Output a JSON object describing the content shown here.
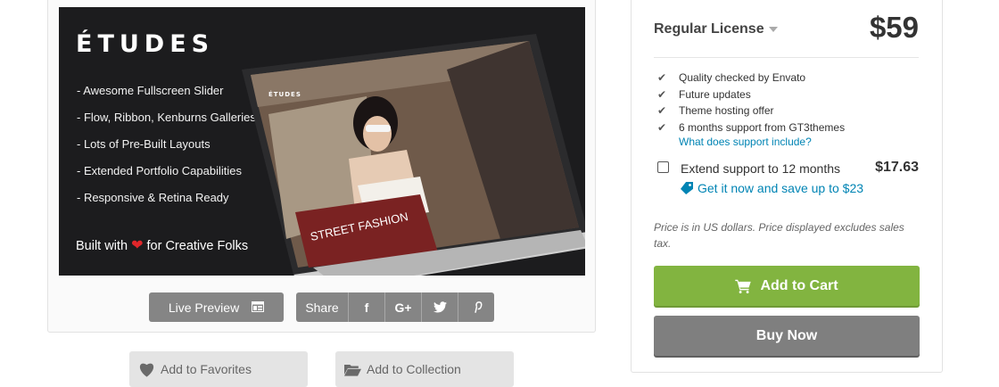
{
  "preview": {
    "banner": {
      "title": "ÉTUDES",
      "features": [
        "- Awesome Fullscreen Slider",
        "- Flow, Ribbon, Kenburns Galleries",
        "- Lots of Pre-Built Layouts",
        "- Extended Portfolio Capabilities",
        "- Responsive & Retina Ready"
      ],
      "built_with_prefix": "Built with",
      "built_with_suffix": "for Creative Folks",
      "screen_caption": "STREET FASHION",
      "screen_logo": "ÉTUDES"
    },
    "live_preview_label": "Live Preview",
    "share_label": "Share",
    "share_icons": [
      "facebook-icon",
      "google-plus-icon",
      "twitter-icon",
      "pinterest-icon"
    ],
    "share_glyphs": [
      "f",
      "G+",
      "",
      ""
    ]
  },
  "actions": {
    "favorites_label": "Add to Favorites",
    "collection_label": "Add to Collection"
  },
  "purchase": {
    "license_label": "Regular License",
    "price": "$59",
    "features": [
      "Quality checked by Envato",
      "Future updates",
      "Theme hosting offer",
      "6 months support from GT3themes"
    ],
    "support_link": "What does support include?",
    "extend_label": "Extend support to 12 months",
    "extend_price": "$17.63",
    "save_link": "Get it now and save up to $23",
    "note": "Price is in US dollars. Price displayed excludes sales tax.",
    "add_to_cart_label": "Add to Cart",
    "buy_now_label": "Buy Now"
  },
  "colors": {
    "accent_green": "#82b440",
    "link_blue": "#0084b4",
    "button_gray": "#858585",
    "heart_red": "#e0262a"
  }
}
